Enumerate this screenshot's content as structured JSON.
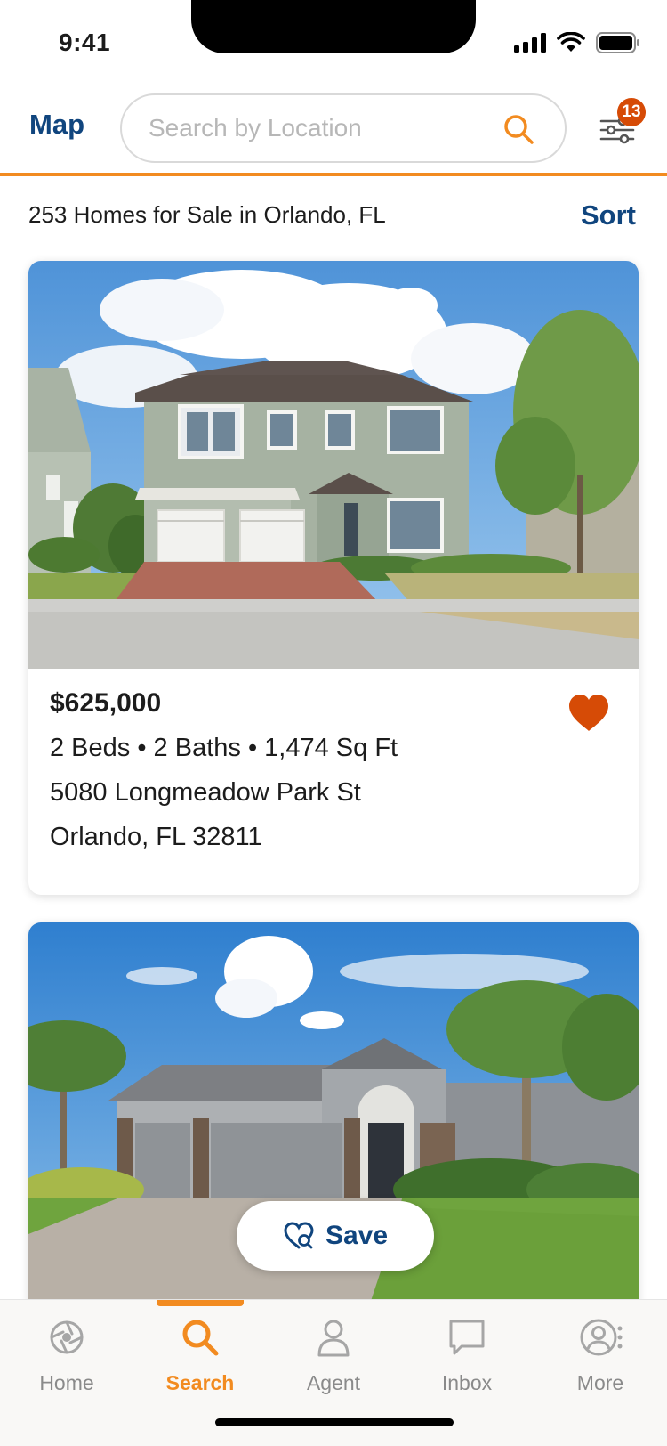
{
  "status_bar": {
    "time": "9:41"
  },
  "header": {
    "map_label": "Map",
    "search_placeholder": "Search by Location",
    "filter_count": "13"
  },
  "results": {
    "count_text": "253 Homes for Sale in Orlando, FL",
    "sort_label": "Sort"
  },
  "listings": [
    {
      "price": "$625,000",
      "specs": "2 Beds • 2 Baths • 1,474 Sq Ft",
      "street": "5080 Longmeadow Park St",
      "city": "Orlando, FL 32811",
      "favorited": true
    },
    {
      "favorited": false
    }
  ],
  "save_button": {
    "label": "Save"
  },
  "tabs": [
    {
      "label": "Home",
      "icon": "home-icon",
      "active": false
    },
    {
      "label": "Search",
      "icon": "search-icon",
      "active": true
    },
    {
      "label": "Agent",
      "icon": "agent-icon",
      "active": false
    },
    {
      "label": "Inbox",
      "icon": "inbox-icon",
      "active": false
    },
    {
      "label": "More",
      "icon": "more-icon",
      "active": false
    }
  ],
  "colors": {
    "accent": "#f28b20",
    "brand_blue": "#10457e",
    "badge": "#d64b06",
    "heart": "#d64b06"
  }
}
